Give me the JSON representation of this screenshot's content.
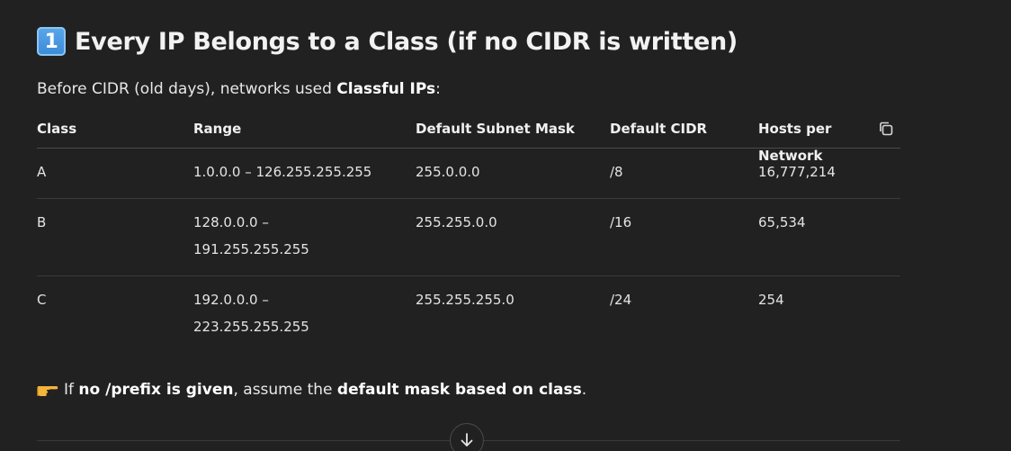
{
  "heading": {
    "number_emoji": "1",
    "title": "Every IP Belongs to a Class (if no CIDR is written)"
  },
  "intro": {
    "prefix": "Before CIDR (old days), networks used ",
    "bold": "Classful IPs",
    "suffix": ":"
  },
  "table": {
    "headers": [
      "Class",
      "Range",
      "Default Subnet Mask",
      "Default CIDR",
      "Hosts per Network"
    ],
    "rows": [
      [
        "A",
        "1.0.0.0 – 126.255.255.255",
        "255.0.0.0",
        "/8",
        "16,777,214"
      ],
      [
        "B",
        "128.0.0.0 – 191.255.255.255",
        "255.255.0.0",
        "/16",
        "65,534"
      ],
      [
        "C",
        "192.0.0.0 – 223.255.255.255",
        "255.255.255.0",
        "/24",
        "254"
      ]
    ]
  },
  "note": {
    "icon": "pointing-hand-icon",
    "t1": "If ",
    "b1": "no /prefix is given",
    "t2": ", assume the ",
    "b2": "default mask based on class",
    "t3": "."
  },
  "icons": {
    "copy": "copy-icon",
    "scroll": "arrow-down-icon"
  }
}
